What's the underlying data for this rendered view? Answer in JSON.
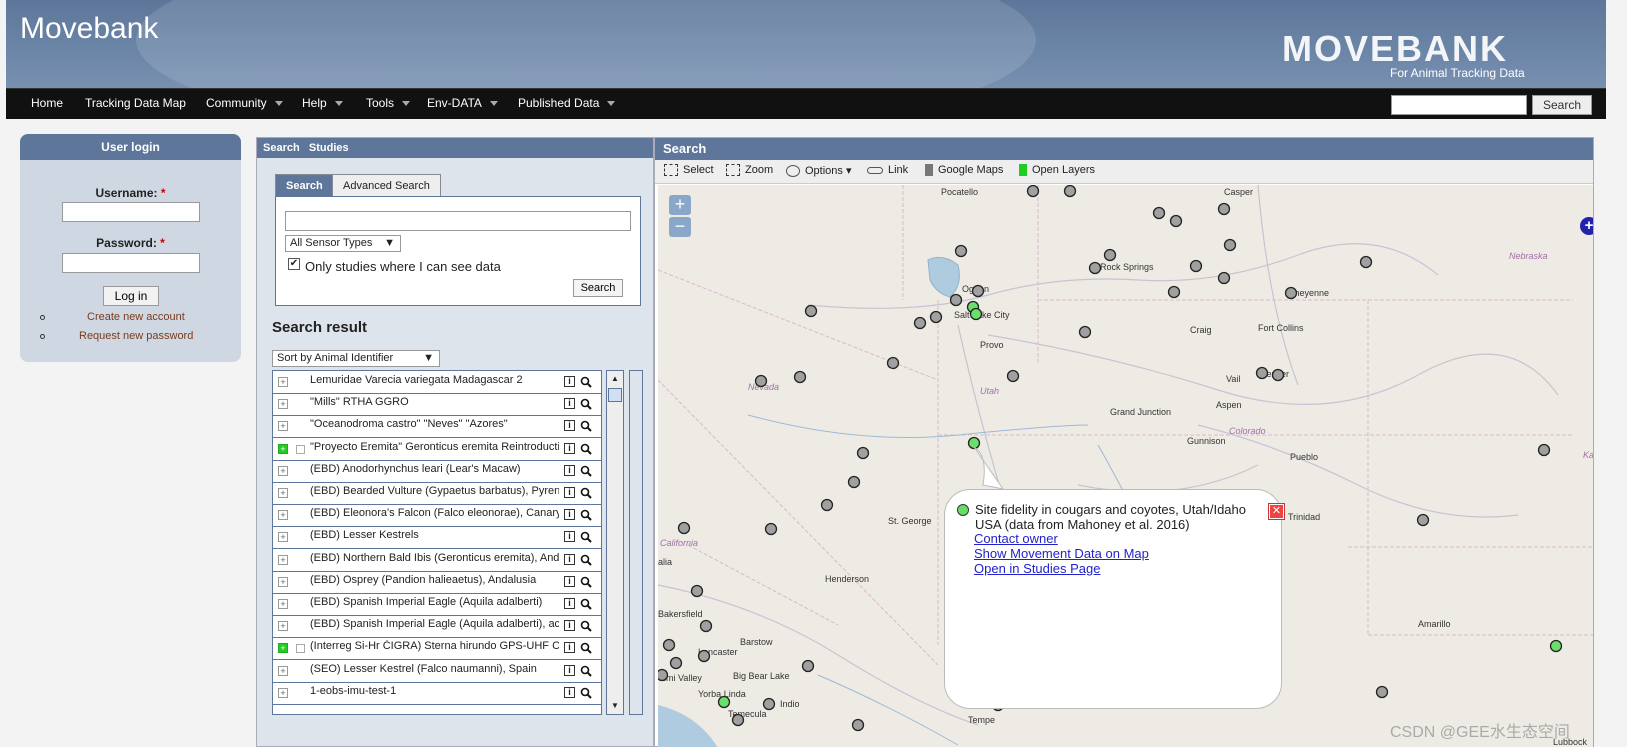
{
  "header": {
    "site_title": "Movebank",
    "logo_text": "MOVEBANK",
    "logo_tagline": "For Animal Tracking Data"
  },
  "nav": {
    "items": [
      "Home",
      "Tracking Data Map",
      "Community",
      "Help",
      "Tools",
      "Env-DATA",
      "Published Data"
    ],
    "search_button": "Search"
  },
  "login": {
    "title": "User login",
    "username_label": "Username:",
    "password_label": "Password:",
    "required_mark": "*",
    "login_button": "Log in",
    "links": [
      "Create new account",
      "Request new password"
    ]
  },
  "left_panel": {
    "header_a": "Search",
    "header_b": "Studies",
    "tabs": [
      "Search",
      "Advanced Search"
    ],
    "sensor_select": "All Sensor Types",
    "only_studies_checked": true,
    "only_studies_label": "Only studies where I can see data",
    "search_button": "Search",
    "result_title": "Search result",
    "sort_select": "Sort by Animal Identifier",
    "results": [
      {
        "name": "Lemuridae Varecia variegata Madagascar 2",
        "green": false
      },
      {
        "name": "\"Mills\" RTHA GGRO",
        "green": false
      },
      {
        "name": "\"Oceanodroma castro\" \"Neves\" \"Azores\"",
        "green": false
      },
      {
        "name": "\"Proyecto Eremita\" Geronticus eremita Reintroduction",
        "green": true
      },
      {
        "name": "(EBD) Anodorhynchus leari (Lear's Macaw)",
        "green": false
      },
      {
        "name": "(EBD) Bearded Vulture (Gypaetus barbatus), Pyrenees",
        "green": false
      },
      {
        "name": "(EBD) Eleonora's Falcon (Falco eleonorae), Canary Is",
        "green": false
      },
      {
        "name": "(EBD) Lesser Kestrels",
        "green": false
      },
      {
        "name": "(EBD) Northern Bald Ibis (Geronticus eremita), Andalu",
        "green": false
      },
      {
        "name": "(EBD) Osprey (Pandion halieaetus), Andalusia",
        "green": false
      },
      {
        "name": "(EBD) Spanish Imperial Eagle (Aquila adalberti)",
        "green": false
      },
      {
        "name": "(EBD) Spanish Imperial Eagle (Aquila adalberti), active",
        "green": false
      },
      {
        "name": "(Interreg Si-Hr ČIGRA) Sterna hirundo GPS-UHF Croa",
        "green": true
      },
      {
        "name": "(SEO) Lesser Kestrel (Falco naumanni), Spain",
        "green": false
      },
      {
        "name": "1-eobs-imu-test-1",
        "green": false
      }
    ]
  },
  "right_panel": {
    "header": "Search",
    "toolbar": [
      "Select",
      "Zoom",
      "Options",
      "Link",
      "Google Maps",
      "Open Layers"
    ],
    "map_labels": [
      "Pocatello",
      "Casper",
      "Rock Springs",
      "Ogden",
      "Salt Lake City",
      "Provo",
      "Craig",
      "Fort Collins",
      "Cheyenne",
      "Nebraska",
      "Nevada",
      "Utah",
      "Vail",
      "Denver",
      "Aspen",
      "Grand Junction",
      "Gunnison",
      "Colorado",
      "Pueblo",
      "St. George",
      "Trinidad",
      "California",
      "Henderson",
      "Barstow",
      "Lancaster",
      "Bakersfield",
      "Big Bear Lake",
      "Yorba Linda",
      "Indio",
      "Temecula",
      "Tempe",
      "Amarillo",
      "Lubbock",
      "Simi Valley",
      "alia",
      "Ka"
    ],
    "popup": {
      "title": "Site fidelity in cougars and coyotes, Utah/Idaho USA (data from Mahoney et al. 2016)",
      "links": [
        "Contact owner",
        "Show Movement Data on Map",
        "Open in Studies Page"
      ]
    }
  },
  "watermark": "CSDN @GEE水生态空间",
  "colors": {
    "header": "#5d7699",
    "nav": "#111111",
    "link": "#2222cc",
    "marker_gray": "#999999",
    "marker_green": "#66dd66"
  }
}
